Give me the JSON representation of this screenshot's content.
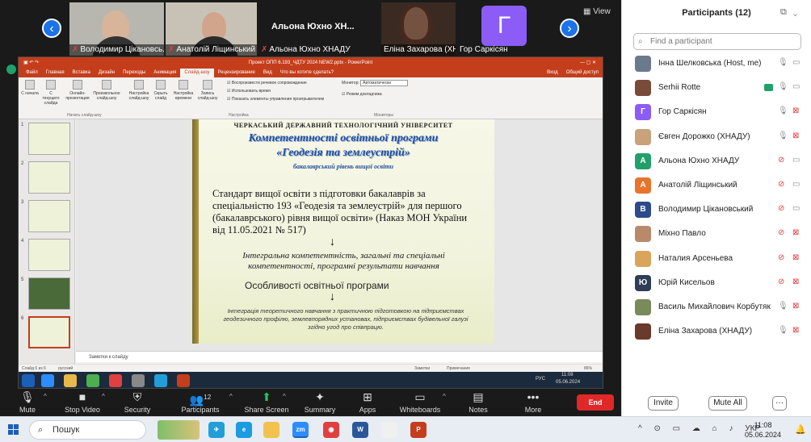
{
  "videos": [
    {
      "name": "Володимир Цікановсь..."
    },
    {
      "name": "Анатолій Ліщинський"
    },
    {
      "name": "Альона Юхно ХНАДУ",
      "display": "Альона Юхно ХН..."
    },
    {
      "name": "Еліна Захарова (ХНАДУ)"
    },
    {
      "name": "Гор Саркісян",
      "initial": "Г"
    }
  ],
  "view_label": "View",
  "ppt": {
    "title": "Проект ОПП 6.193_ЧДТУ 2024 NEW2.pptx - PowerPoint",
    "signin": "Вход",
    "share": "Общий доступ",
    "tabs": [
      "Файл",
      "Главная",
      "Вставка",
      "Дизайн",
      "Переходы",
      "Анимация",
      "Слайд-шоу",
      "Рецензирование",
      "Вид",
      "Что вы хотите сделать?"
    ],
    "ribbon": {
      "buttons": [
        "С начала",
        "С текущего слайда",
        "Онлайн-презентация",
        "Произвольное слайд-шоу",
        "Настройка слайд-шоу",
        "Скрыть слайд",
        "Настройка времени",
        "Запись слайд-шоу"
      ],
      "checks": [
        "Воспроизвести речевое сопровождение",
        "Использовать время",
        "Показать элементы управления проигрывателем",
        "Режим докладчика"
      ],
      "monitor_label": "Монитор:",
      "monitor_value": "Автоматически",
      "groups": [
        "Начать слайд-шоу",
        "Настройка",
        "Мониторы"
      ]
    },
    "thumb_numbers": [
      "1",
      "2",
      "3",
      "4",
      "5",
      "6"
    ],
    "slide": {
      "university": "ЧЕРКАСЬКИЙ ДЕРЖАВНИЙ ТЕХНОЛОГІЧНИЙ УНІВЕРСИТЕТ",
      "title1": "Компетентності освітньої програми",
      "title2": "«Геодезія та землеустрій»",
      "subtitle": "бакалаврський рівень вищої освіти",
      "standard": "Стандарт вищої освіти з підготовки бакалаврів за спеціальністю 193 «Геодезія та землеустрій» для першого (бакалаврського) рівня вищої освіти» (Наказ МОН України від 11.05.2021 № 517)",
      "arrow": "↓",
      "competences": "Інтегральна компетентність, загальні та спеціальні компетентності, програмні результати навчання",
      "features": "Особливості освітньої програми",
      "integration": "Інтеграція теоретичного навчання з практичною підготовкою на підприємствах геодезичного профілю, землевпорядних установах, підприємствах будівельної галузі згідно угод про співпрацю."
    },
    "notes_placeholder": "Заметки к слайду",
    "status_slide": "Слайд 6 из 6",
    "status_lang": "русский",
    "status_notes": "Заметки",
    "status_comments": "Примечания",
    "zoom": "86%",
    "inner_clock_time": "11:08",
    "inner_clock_date": "05.06.2024",
    "inner_lang": "РУС"
  },
  "toolbar": {
    "mute": "Mute",
    "stop_video": "Stop Video",
    "security": "Security",
    "participants": "Participants",
    "participants_count": "12",
    "share_screen": "Share Screen",
    "summary": "Summary",
    "apps": "Apps",
    "whiteboards": "Whiteboards",
    "notes": "Notes",
    "more": "More",
    "end": "End"
  },
  "panel": {
    "title": "Participants (12)",
    "search_placeholder": "Find a participant",
    "participants": [
      {
        "name": "Інна Шелковська (Host, me)",
        "initial": "",
        "color": "#6a7a8c",
        "mic_muted": false,
        "cam_off": false
      },
      {
        "name": "Serhii Rotte",
        "initial": "",
        "color": "#7a4a3a",
        "mic_muted": false,
        "cam_off": false,
        "sharing": true
      },
      {
        "name": "Гор Саркісян",
        "initial": "Г",
        "color": "#8b5cf6",
        "mic_muted": false,
        "cam_off": true
      },
      {
        "name": "Євген Дорожко (ХНАДУ)",
        "initial": "",
        "color": "#c8a27a",
        "mic_muted": false,
        "cam_off": true
      },
      {
        "name": "Альона Юхно ХНАДУ",
        "initial": "А",
        "color": "#22a06b",
        "mic_muted": true,
        "cam_off": false
      },
      {
        "name": "Анатолій Ліщинський",
        "initial": "А",
        "color": "#e8742c",
        "mic_muted": true,
        "cam_off": false
      },
      {
        "name": "Володимир Цікановський",
        "initial": "В",
        "color": "#2d4a8a",
        "mic_muted": true,
        "cam_off": false
      },
      {
        "name": "Міхно Павло",
        "initial": "",
        "color": "#b98a6a",
        "mic_muted": true,
        "cam_off": true
      },
      {
        "name": "Наталия Арсеньева",
        "initial": "",
        "color": "#d9a55a",
        "mic_muted": true,
        "cam_off": true
      },
      {
        "name": "Юрій Кисельов",
        "initial": "Ю",
        "color": "#2f3d55",
        "mic_muted": true,
        "cam_off": true
      },
      {
        "name": "Василь Михайлович Корбутяк",
        "initial": "",
        "color": "#7a8a5a",
        "mic_muted": false,
        "cam_off": true
      },
      {
        "name": "Еліна Захарова (ХНАДУ)",
        "initial": "",
        "color": "#6a3a2a",
        "mic_muted": false,
        "cam_off": true
      }
    ],
    "invite": "Invite",
    "mute_all": "Mute All",
    "more": "···"
  },
  "taskbar": {
    "search": "Пошук",
    "lang": "УКР",
    "time": "11:08",
    "date": "05.06.2024"
  }
}
